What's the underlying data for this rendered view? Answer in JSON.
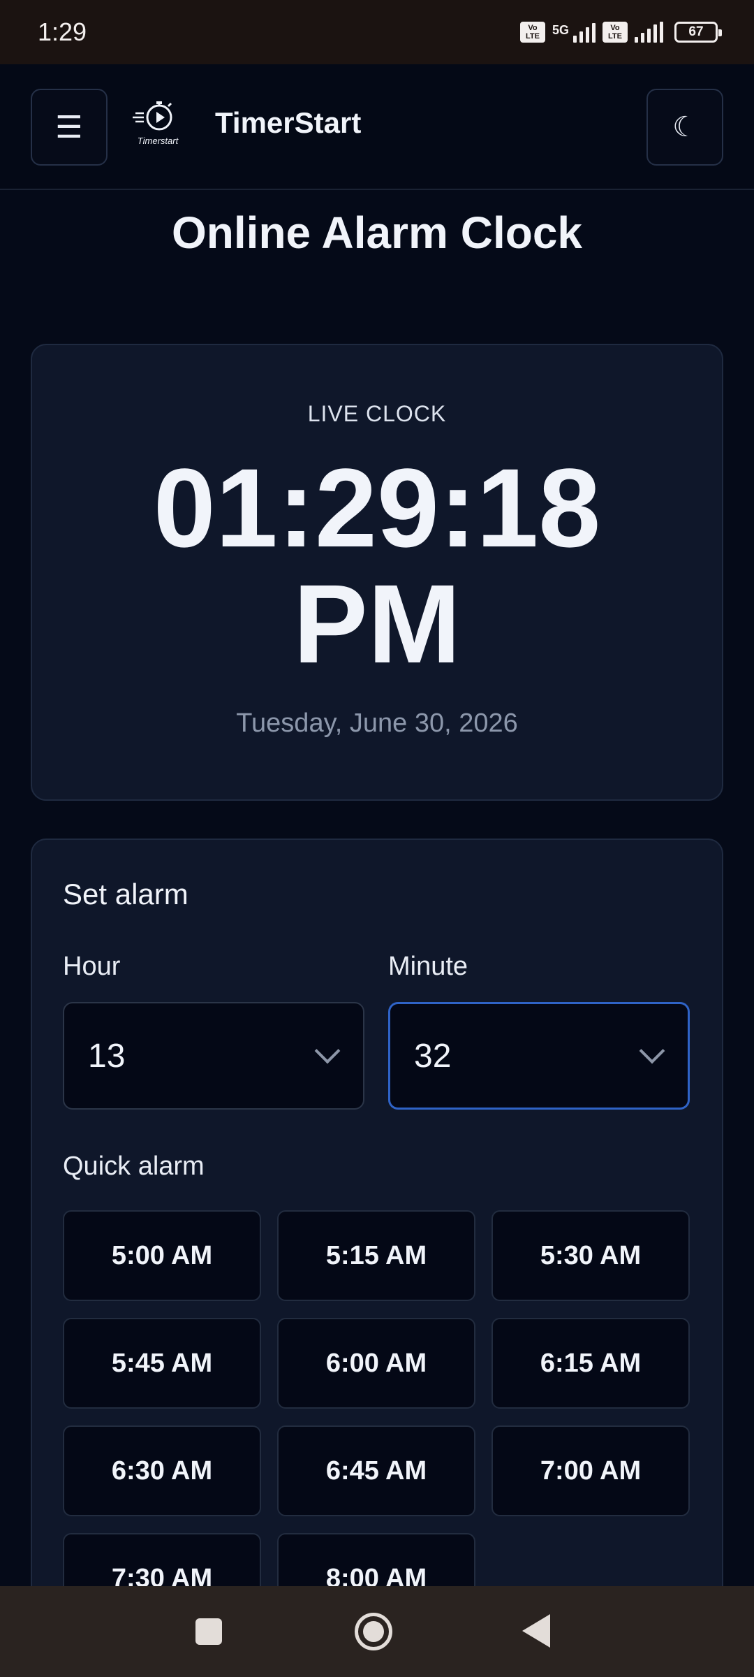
{
  "status_bar": {
    "time": "1:29",
    "network": "5G",
    "volte_1": "Vo LTE",
    "volte_2": "Vo LTE",
    "battery": "67"
  },
  "header": {
    "menu_icon": "☰",
    "logo_text": "Timerstart",
    "brand_name": "TimerStart",
    "theme_icon": "☾"
  },
  "page": {
    "title": "Online Alarm Clock"
  },
  "clock": {
    "label": "LIVE CLOCK",
    "time": "01:29:18",
    "period": "PM",
    "date": "Tuesday, June 30, 2026"
  },
  "alarm": {
    "heading": "Set alarm",
    "hour_label": "Hour",
    "hour_value": "13",
    "minute_label": "Minute",
    "minute_value": "32",
    "quick_heading": "Quick alarm",
    "quick_options": [
      "5:00 AM",
      "5:15 AM",
      "5:30 AM",
      "5:45 AM",
      "6:00 AM",
      "6:15 AM",
      "6:30 AM",
      "6:45 AM",
      "7:00 AM",
      "7:30 AM",
      "8:00 AM"
    ]
  },
  "colors": {
    "background": "#050a18",
    "card": "#0f172a",
    "focus_accent": "#2f63c7"
  }
}
